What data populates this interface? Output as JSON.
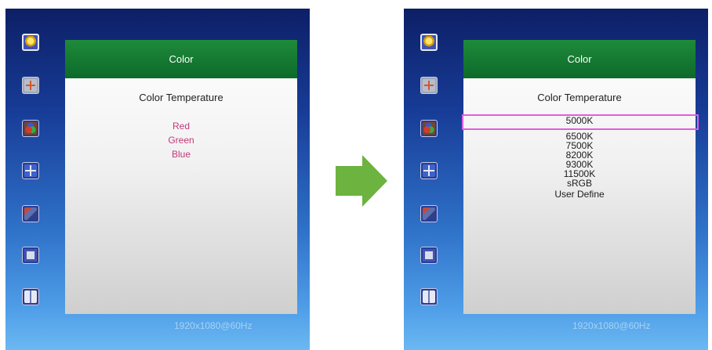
{
  "left_osd": {
    "title": "Color",
    "subtitle": "Color Temperature",
    "items": [
      "Red",
      "Green",
      "Blue"
    ],
    "status": "1920x1080@60Hz"
  },
  "right_osd": {
    "title": "Color",
    "subtitle": "Color Temperature",
    "items": [
      "5000K",
      "6500K",
      "7500K",
      "8200K",
      "9300K",
      "11500K",
      "sRGB",
      "User Define"
    ],
    "selected_item": "5000K",
    "status": "1920x1080@60Hz"
  },
  "menu_icons": [
    "brightness-icon",
    "position-icon",
    "color-icon",
    "image-adjust-icon",
    "audio-icon",
    "osd-setup-icon",
    "misc-icon"
  ],
  "colors": {
    "header_green": "#0d6a2a",
    "highlight": "#e05ce0",
    "rgb_text": "#c2387a",
    "arrow": "#6cb33f"
  }
}
